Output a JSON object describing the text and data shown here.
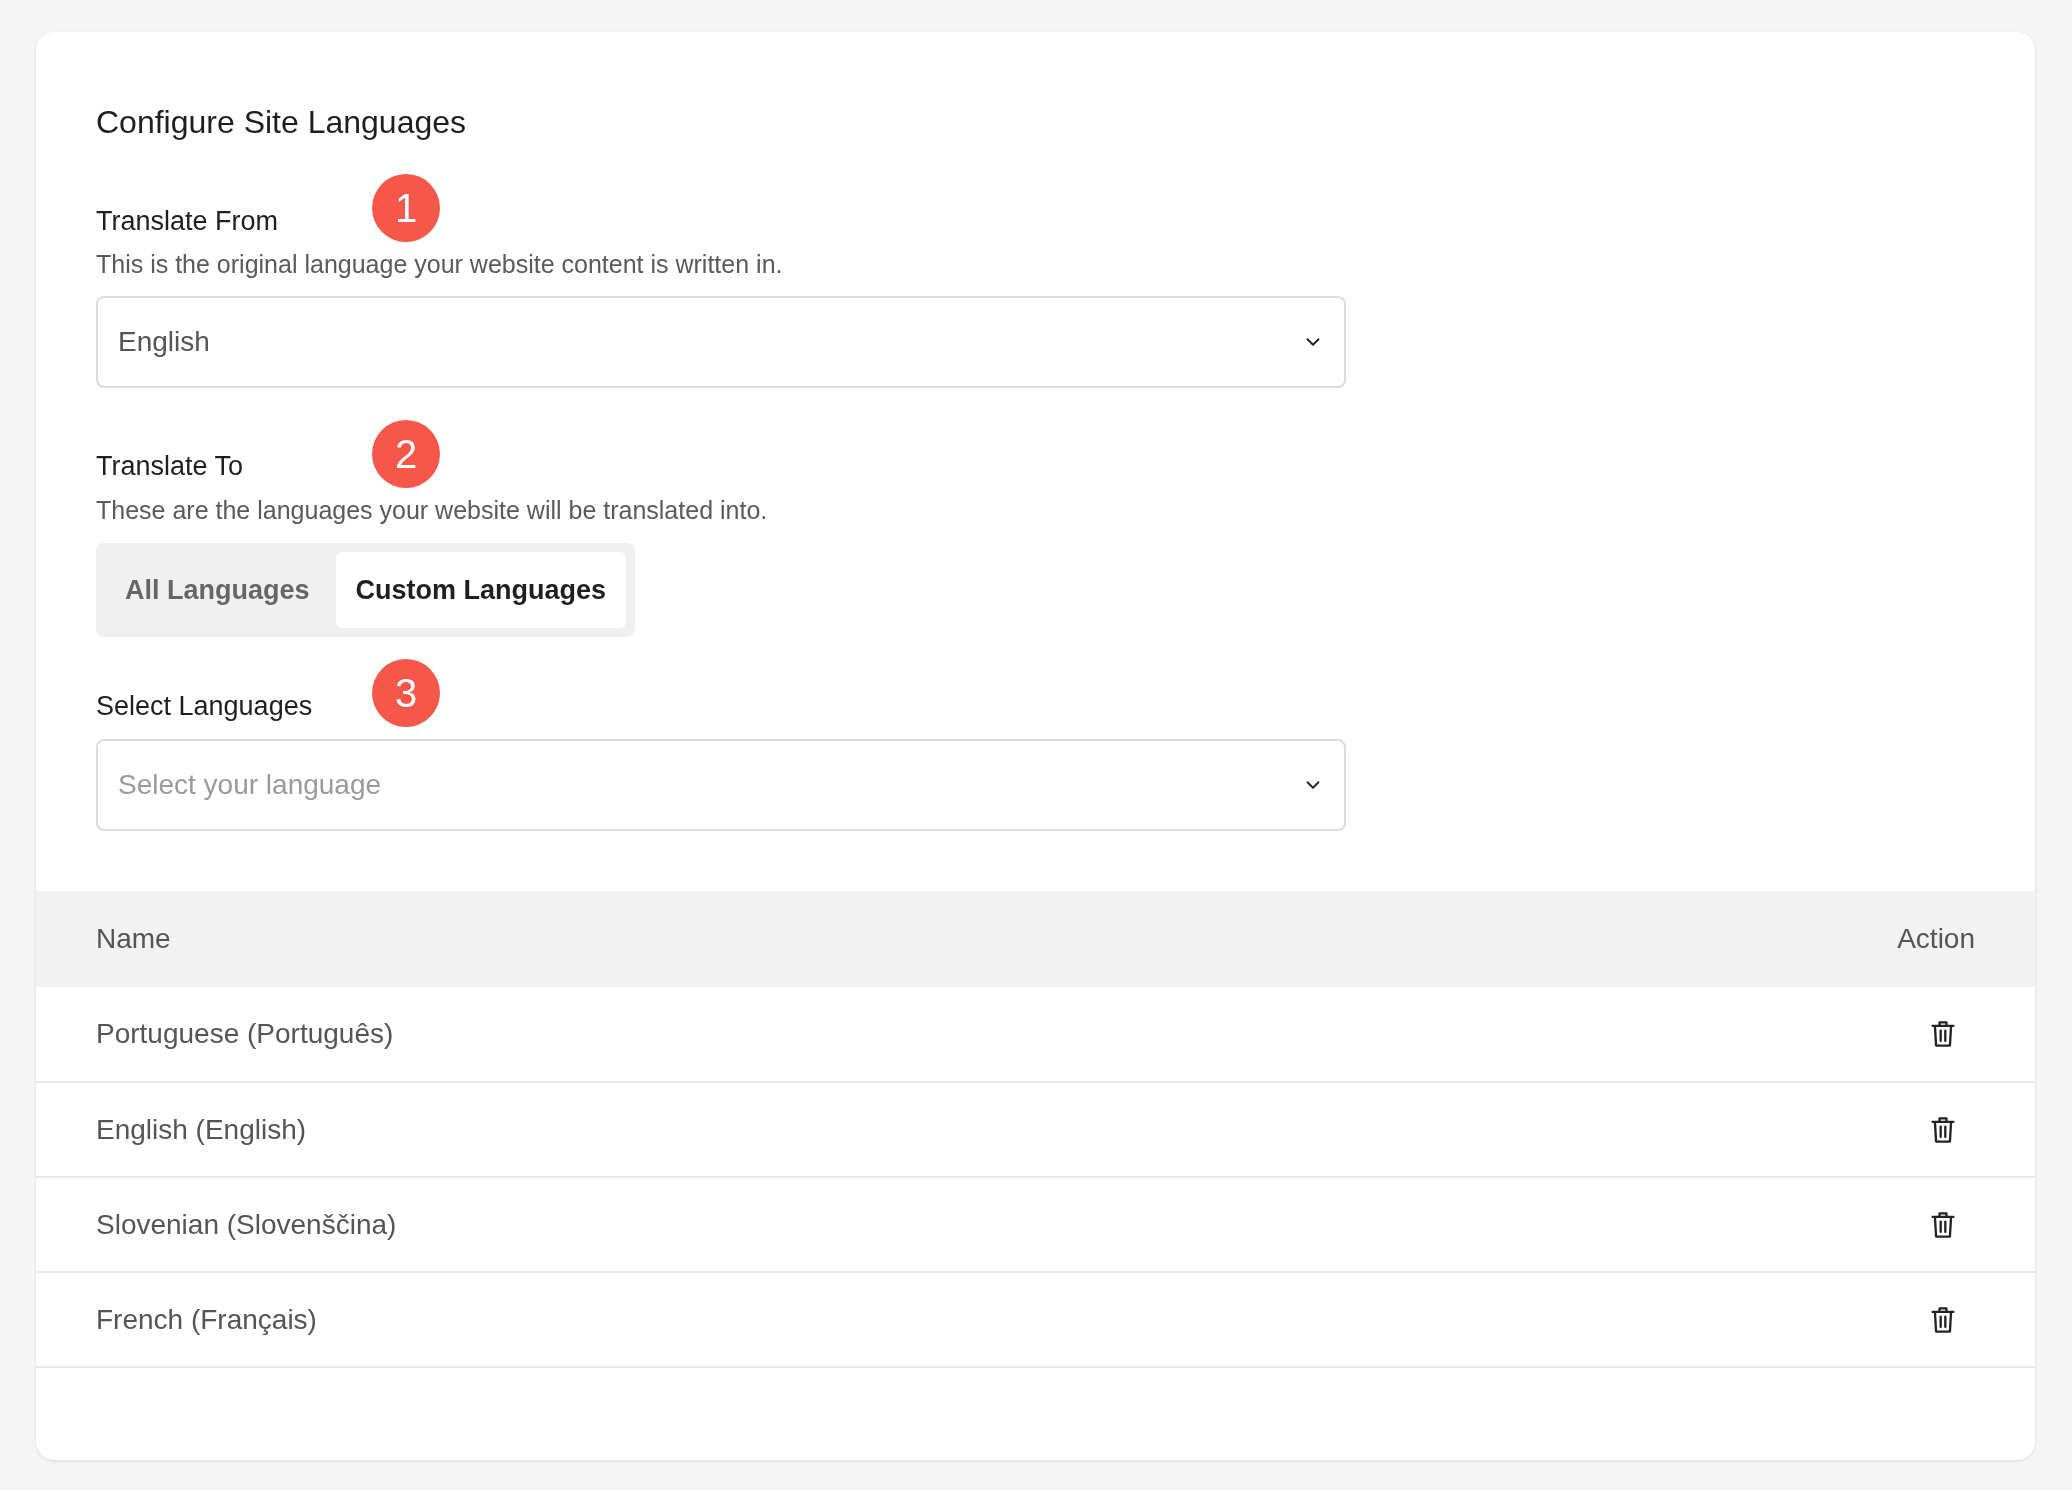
{
  "title": "Configure Site Languages",
  "translate_from": {
    "label": "Translate From",
    "step": "1",
    "description": "This is the original language your website content is written in.",
    "select": {
      "value": "English"
    }
  },
  "translate_to": {
    "label": "Translate To",
    "step": "2",
    "description": "These are the languages your website will be translated into.",
    "tabs": [
      {
        "label": "All Languages",
        "selected": false
      },
      {
        "label": "Custom Languages",
        "selected": true
      }
    ]
  },
  "select_languages": {
    "label": "Select Languages",
    "step": "3",
    "select": {
      "placeholder": "Select your language"
    }
  },
  "table": {
    "columns": [
      "Name",
      "Action"
    ],
    "rows": [
      {
        "name": "Portuguese (Português)"
      },
      {
        "name": "English (English)"
      },
      {
        "name": "Slovenian (Slovenščina)"
      },
      {
        "name": "French (Français)"
      }
    ]
  }
}
